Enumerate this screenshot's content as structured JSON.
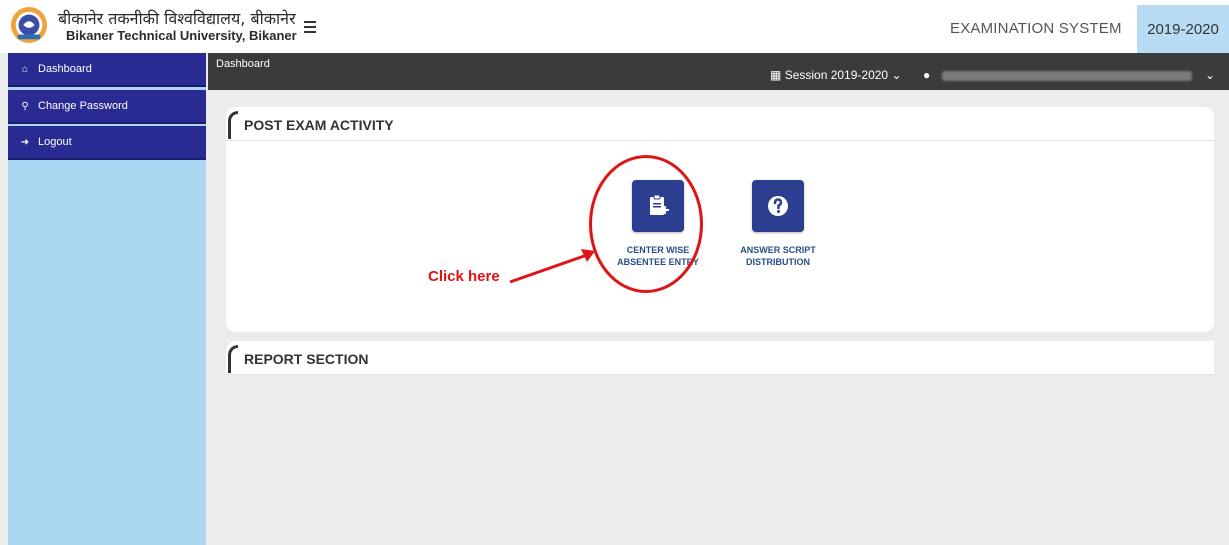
{
  "header": {
    "university_name_hindi": "बीकानेर तकनीकी विश्वविद्यालय, बीकानेर",
    "university_name_english": "Bikaner Technical University, Bikaner",
    "system_title": "EXAMINATION SYSTEM",
    "year": "2019-2020"
  },
  "subheader": {
    "breadcrumb": "Dashboard",
    "session_label": "Session  2019-2020",
    "session_icon": "calendar-icon",
    "user_icon": "user-icon"
  },
  "sidebar": {
    "items": [
      {
        "label": "Dashboard",
        "icon": "home-icon"
      },
      {
        "label": "Change Password",
        "icon": "key-icon"
      },
      {
        "label": "Logout",
        "icon": "logout-icon"
      }
    ]
  },
  "post_exam": {
    "title": "POST EXAM ACTIVITY",
    "tiles": [
      {
        "line1": "CENTER WISE",
        "line2": "ABSENTEE ENTRY",
        "icon": "clipboard-add-icon"
      },
      {
        "line1": "ANSWER SCRIPT",
        "line2": "DISTRIBUTION",
        "icon": "question-icon"
      }
    ]
  },
  "annotation": {
    "text": "Click here",
    "color": "#e01414"
  },
  "report": {
    "title": "REPORT SECTION"
  },
  "colors": {
    "sidebar_bg": "#a9d7f2",
    "menu_item": "#2a2a93",
    "tile": "#2c3e8f",
    "subbar": "#3b3b3b",
    "year_badge": "#b8dcf3"
  }
}
